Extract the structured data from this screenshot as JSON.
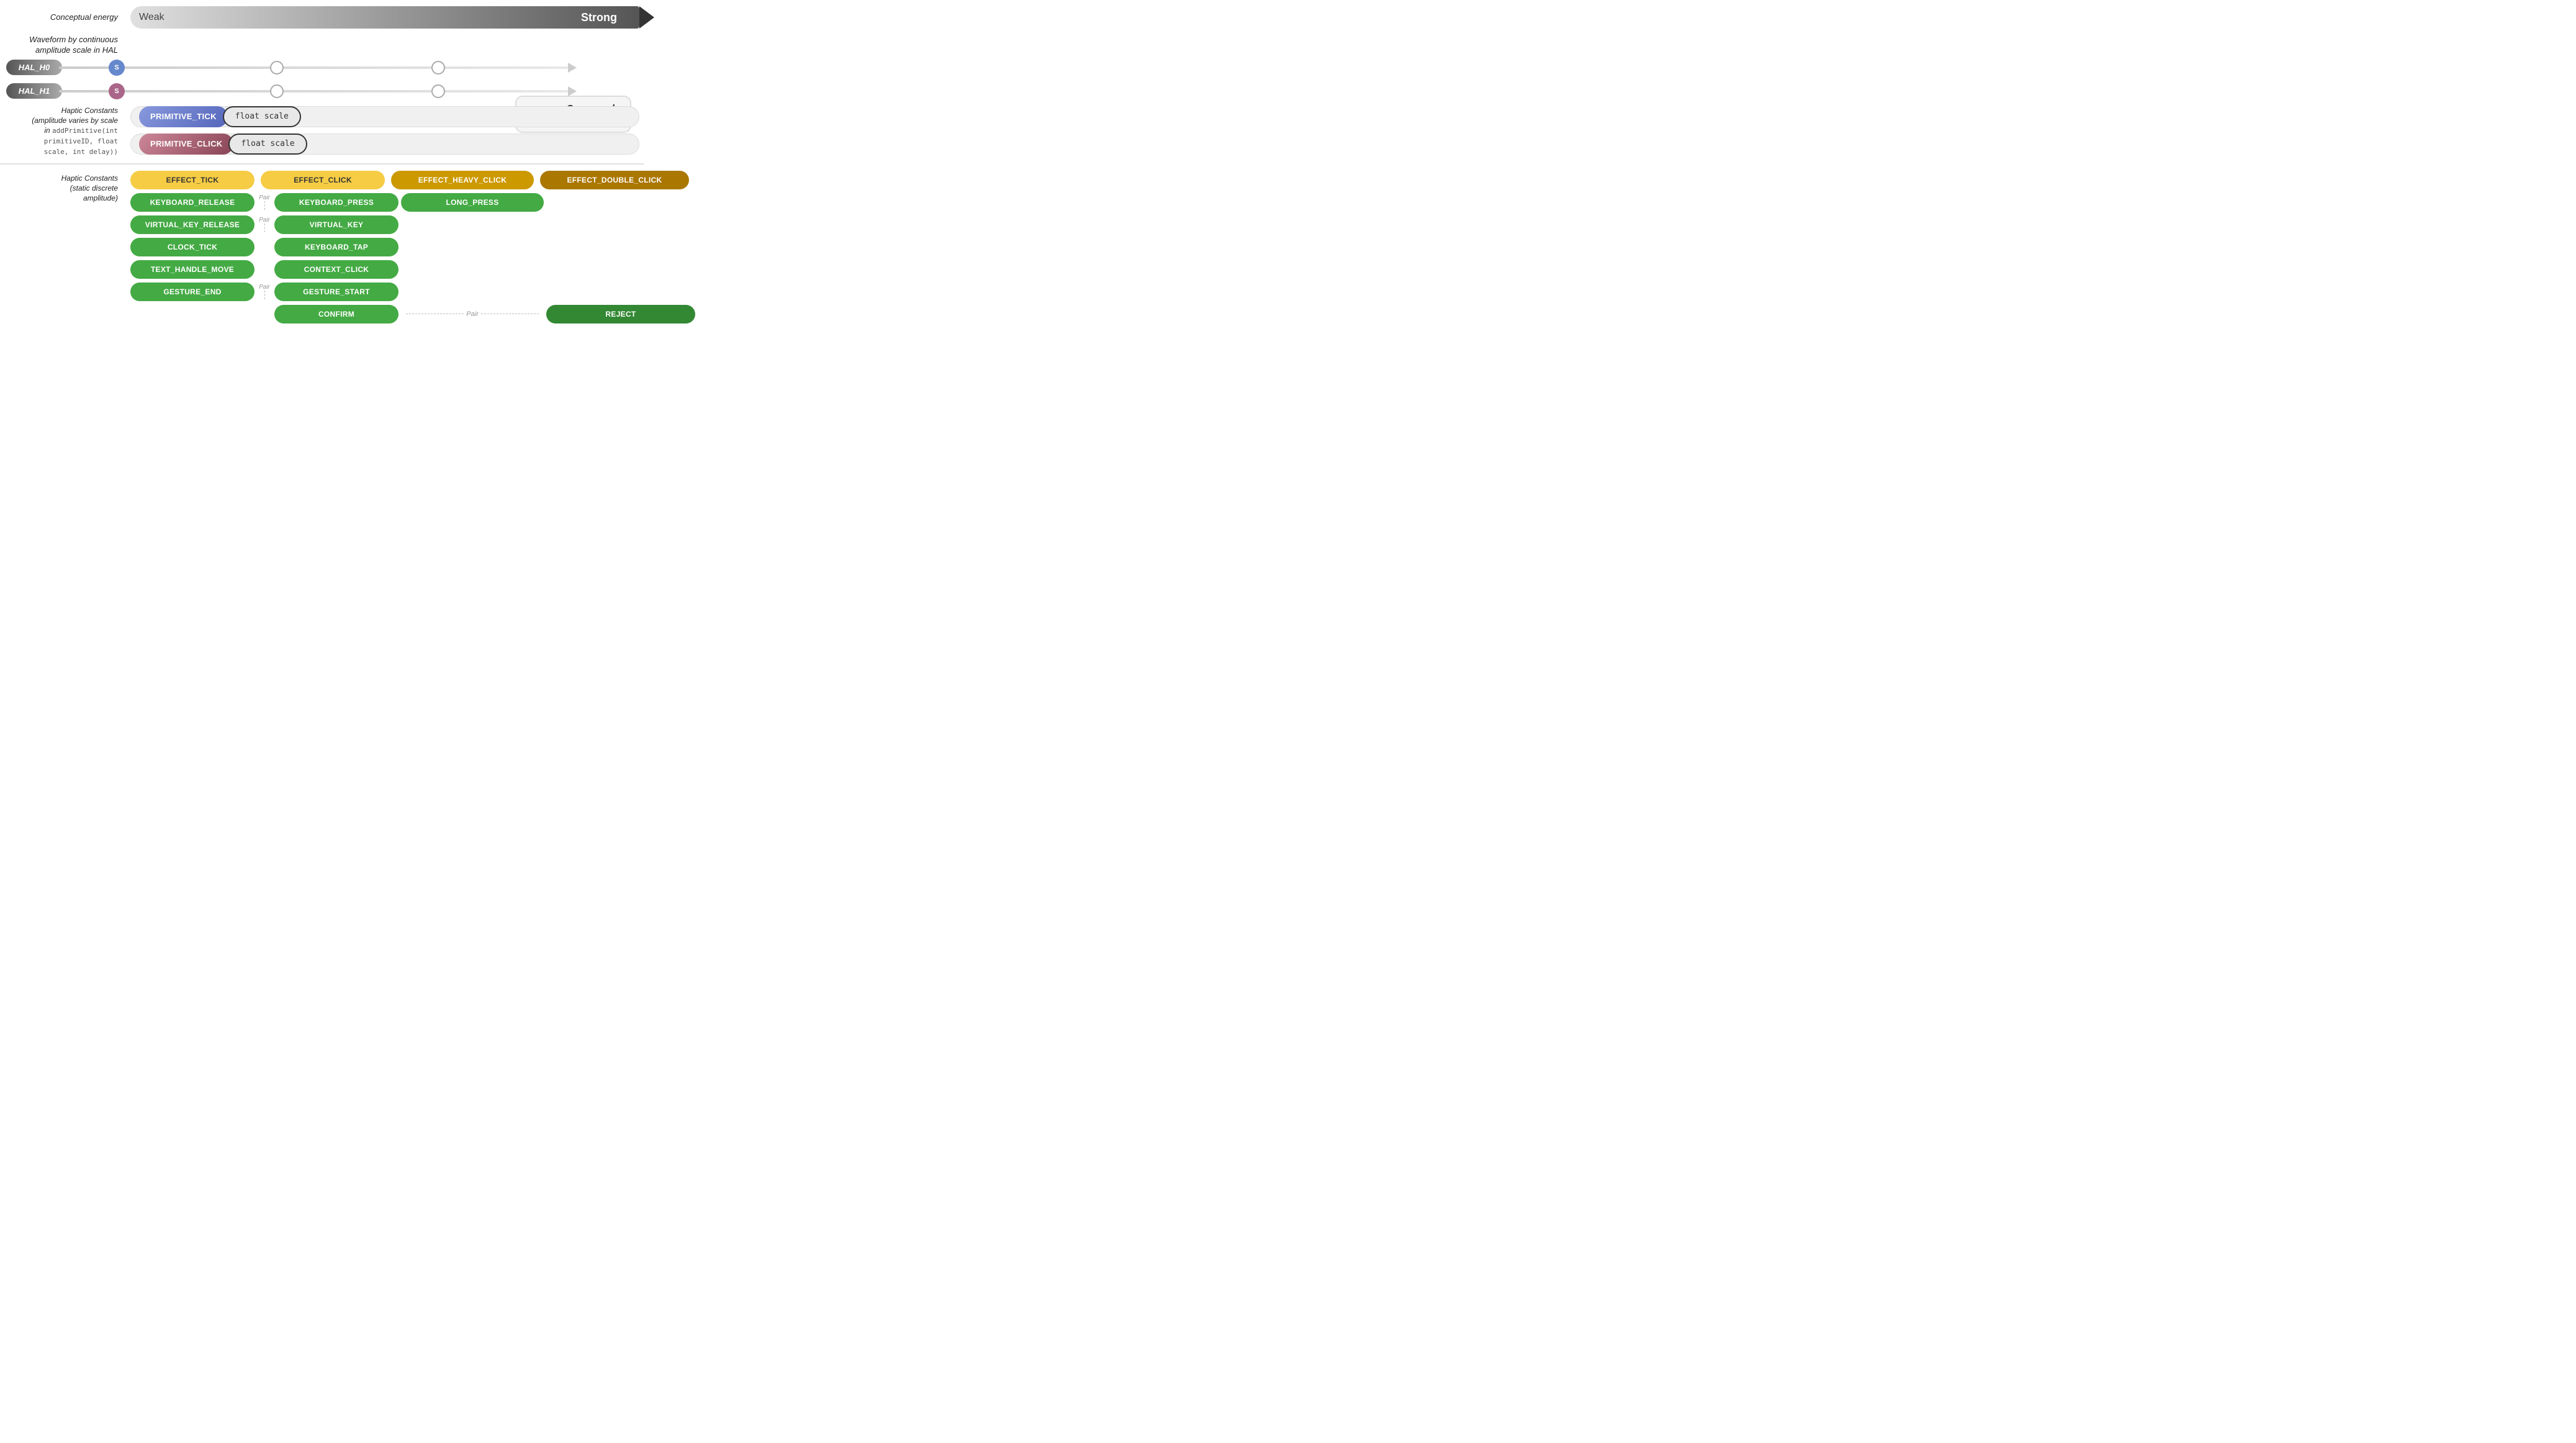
{
  "conceptualEnergy": {
    "label": "Conceptual energy",
    "weakLabel": "Weak",
    "strongLabel": "Strong"
  },
  "waveformLabel": "Waveform by continuous\namplitude scale in HAL",
  "hal": {
    "h0": {
      "label": "HAL_H0",
      "startDot": "S",
      "color": "#6688cc"
    },
    "h1": {
      "label": "HAL_H1",
      "startDot": "S",
      "color": "#aa6688"
    }
  },
  "composedDoubleClick": {
    "text": "Composed\ndouble click"
  },
  "hapticConstantsTopLabel": "Haptic Constants\n(amplitude varies by scale\nin addPrimitive(int\nprimitiveID, float\nscale, int delay))",
  "primitives": [
    {
      "name": "PRIMITIVE_TICK",
      "param": "float scale",
      "colorClass": "primitive-tick-bg"
    },
    {
      "name": "PRIMITIVE_CLICK",
      "param": "float scale",
      "colorClass": "primitive-click-bg"
    }
  ],
  "hapticConstantsBottomLabel": "Haptic Constants\n(static discrete\namplitude)",
  "effects": {
    "row1": [
      {
        "label": "EFFECT_TICK",
        "style": "effect-yellow",
        "col": 1
      },
      {
        "label": "EFFECT_CLICK",
        "style": "effect-yellow",
        "col": 2
      },
      {
        "label": "EFFECT_HEAVY_CLICK",
        "style": "effect-yellow-dark",
        "col": 3
      },
      {
        "label": "EFFECT_DOUBLE_CLICK",
        "style": "effect-yellow-darkest",
        "col": 4
      }
    ],
    "row2": [
      {
        "label": "KEYBOARD_RELEASE",
        "style": "effect-green",
        "col": 1
      },
      {
        "label": "KEYBOARD_PRESS",
        "style": "effect-green",
        "col": 2
      },
      {
        "label": "LONG_PRESS",
        "style": "effect-green",
        "col": 3
      }
    ],
    "row3": [
      {
        "label": "VIRTUAL_KEY_RELEASE",
        "style": "effect-green",
        "col": 1
      },
      {
        "label": "VIRTUAL_KEY",
        "style": "effect-green",
        "col": 2
      }
    ],
    "row4": [
      {
        "label": "CLOCK_TICK",
        "style": "effect-green",
        "col": 1
      },
      {
        "label": "KEYBOARD_TAP",
        "style": "effect-green",
        "col": 2
      }
    ],
    "row5": [
      {
        "label": "TEXT_HANDLE_MOVE",
        "style": "effect-green",
        "col": 1
      },
      {
        "label": "CONTEXT_CLICK",
        "style": "effect-green",
        "col": 2
      }
    ],
    "row6": [
      {
        "label": "GESTURE_END",
        "style": "effect-green",
        "col": 1
      },
      {
        "label": "GESTURE_START",
        "style": "effect-green",
        "col": 2
      }
    ],
    "row7": [
      {
        "label": "CONFIRM",
        "style": "effect-green",
        "col": 2
      },
      {
        "label": "REJECT",
        "style": "effect-green-dark",
        "col": 4
      }
    ]
  },
  "pairLabel": "Pair"
}
